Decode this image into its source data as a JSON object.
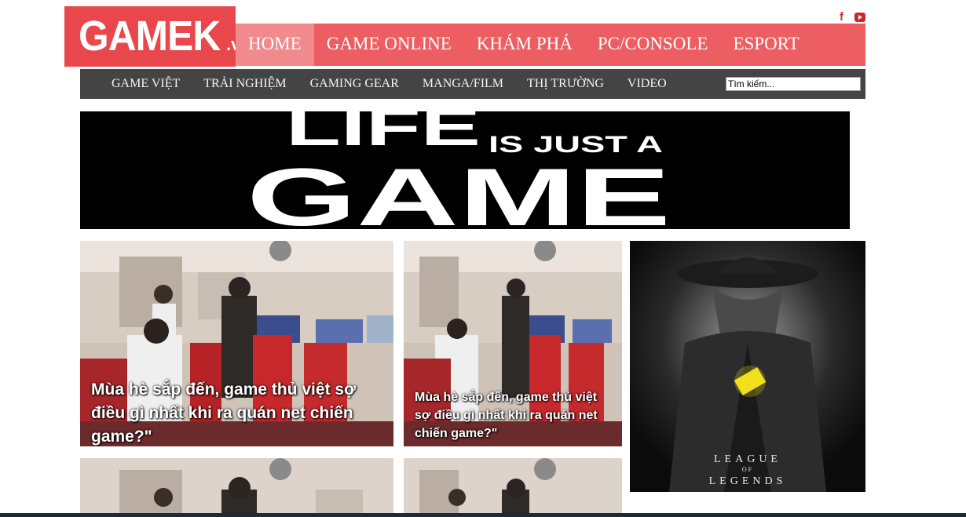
{
  "header": {
    "logo_text": "GAMEK",
    "logo_suffix": ".vn",
    "main_nav": [
      "HOME",
      "GAME ONLINE",
      "KHÁM PHÁ",
      "PC/CONSOLE",
      "ESPORT"
    ],
    "social": {
      "facebook": "f",
      "youtube_icon": "youtube-icon"
    }
  },
  "sub_nav": [
    "GAME VIỆT",
    "TRẢI NGHIỆM",
    "GAMING GEAR",
    "MANGA/FILM",
    "THỊ TRƯỜNG",
    "VIDEO"
  ],
  "search": {
    "value": "Tìm kiếm..."
  },
  "banner": {
    "line1": "LIFE",
    "line2": "IS JUST A",
    "line3": "GAME"
  },
  "articles": [
    {
      "title": "Mùa hè sắp đến, game thủ việt sợ điều gì nhất khi ra quán net chiến game?\""
    },
    {
      "title": "Mùa hè sắp đến, game thủ việt sợ điều gì nhất khi ra quán net chiến game?\""
    }
  ],
  "ad": {
    "line1": "LEAGUE",
    "line2": "OF",
    "line3": "LEGENDS"
  },
  "colors": {
    "brand_red": "#e8484b",
    "nav_red": "#ec5e61",
    "nav_active": "#f08a8c",
    "subnav_bg": "#444444"
  }
}
